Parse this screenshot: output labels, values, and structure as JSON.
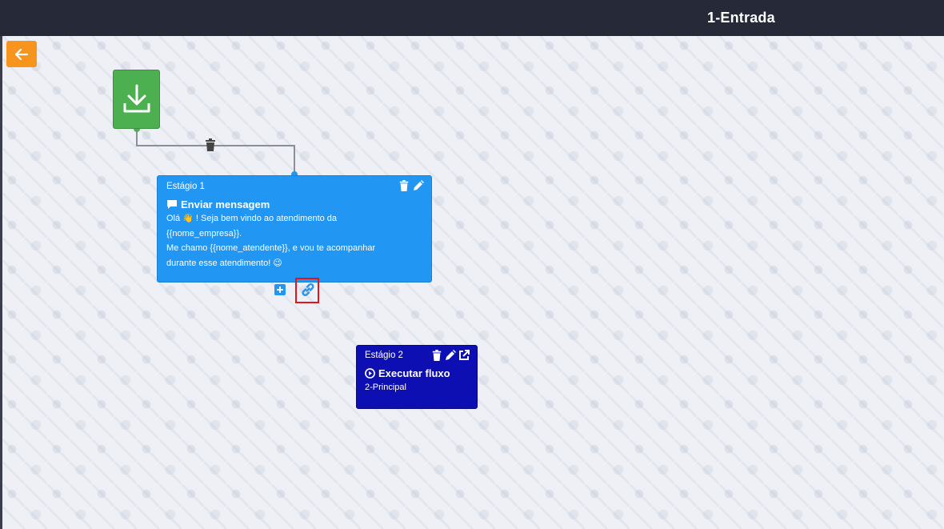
{
  "header": {
    "title": "1-Entrada"
  },
  "colors": {
    "topbar": "#262938",
    "back_button": "#f7941d",
    "start_node": "#4caf50",
    "stage1": "#2196f3",
    "stage2": "#0e0fb3",
    "highlight": "#e3151a"
  },
  "toolbar": {
    "back_icon": "arrow-left-icon"
  },
  "start_node": {
    "icon": "download-icon"
  },
  "stage1": {
    "label": "Estágio 1",
    "action": "Enviar mensagem",
    "action_icon": "comment-icon",
    "message_lines": [
      "Olá 👋 ! Seja bem vindo ao atendimento da",
      "{{nome_empresa}}.",
      "Me chamo {{nome_atendente}}, e vou te acompanhar",
      "durante esse atendimento! 😉"
    ]
  },
  "stage2": {
    "label": "Estágio 2",
    "action": "Executar fluxo",
    "action_icon": "play-circle-icon",
    "target": "2-Principal"
  }
}
